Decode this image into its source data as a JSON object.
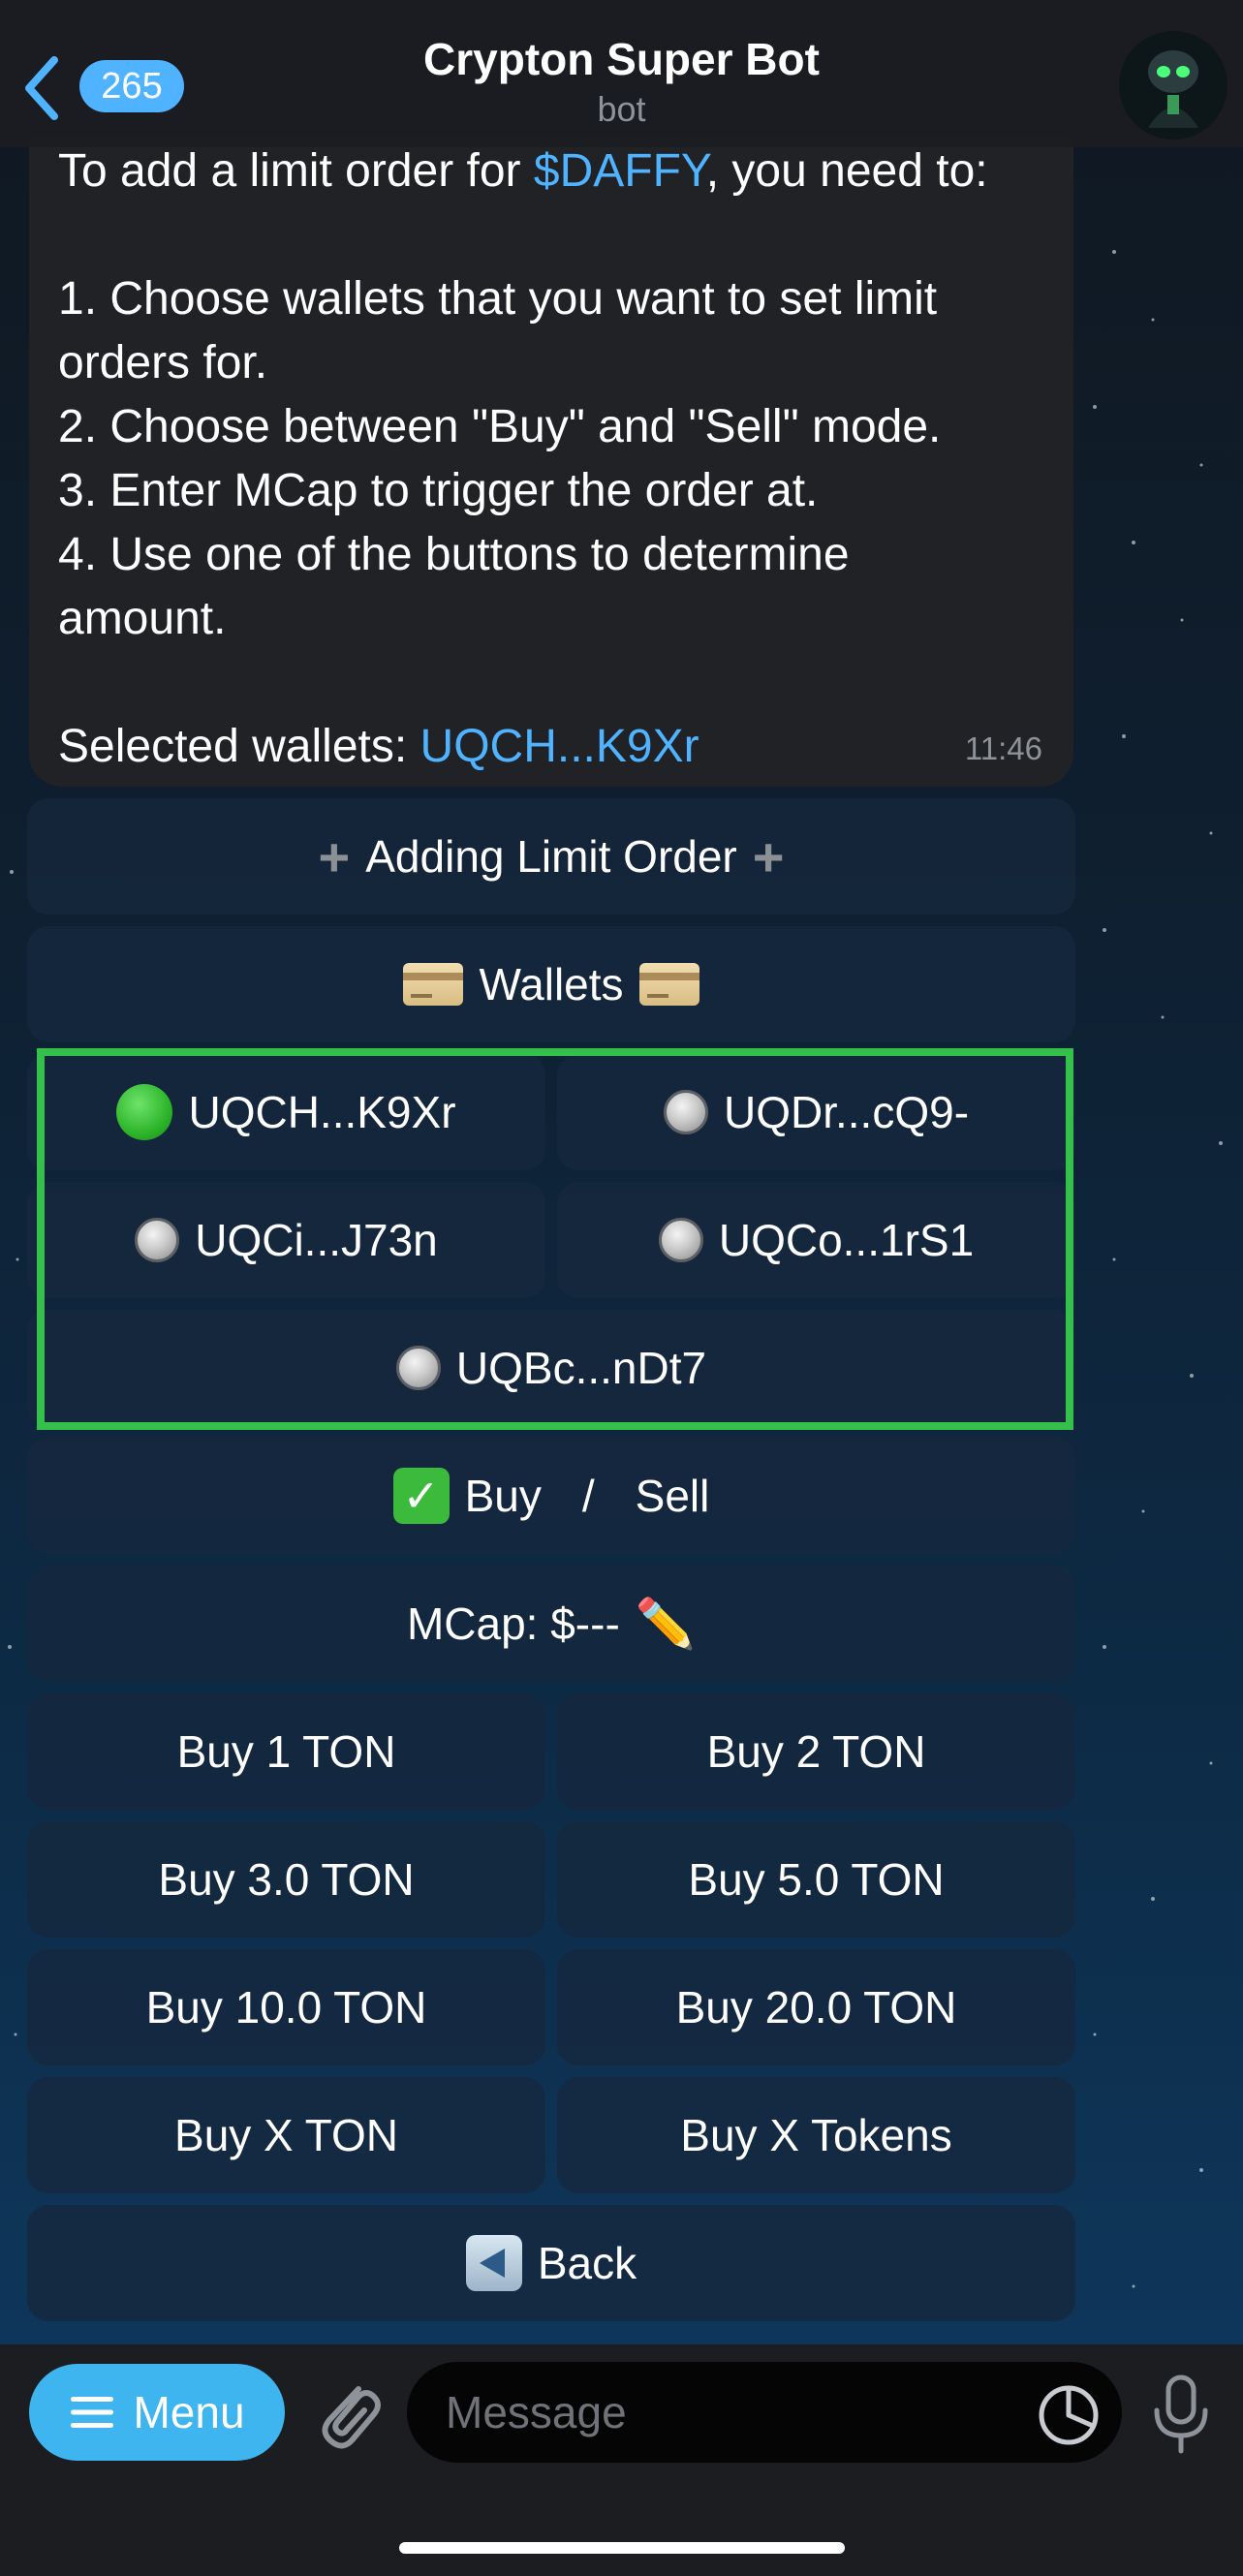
{
  "header": {
    "back_badge": "265",
    "title": "Crypton Super Bot",
    "subtitle": "bot"
  },
  "message": {
    "line1_pre": "To add a limit order for ",
    "line1_link": "$DAFFY",
    "line1_post": ", you need to:",
    "line2": "1. Choose wallets that you want to set limit",
    "line3": "orders for.",
    "line4": "2. Choose between \"Buy\" and \"Sell\" mode.",
    "line5": "3. Enter MCap to trigger the order at.",
    "line6": "4. Use one of the buttons to determine",
    "line7": "amount.",
    "selected_label": "Selected wallets: ",
    "selected_value": "UQCH...K9Xr",
    "time": "11:46"
  },
  "keyboard": {
    "adding": "Adding Limit Order",
    "wallets": "Wallets",
    "wallet_list": [
      {
        "label": "UQCH...K9Xr",
        "selected": true
      },
      {
        "label": "UQDr...cQ9-",
        "selected": false
      },
      {
        "label": "UQCi...J73n",
        "selected": false
      },
      {
        "label": "UQCo...1rS1",
        "selected": false
      },
      {
        "label": "UQBc...nDt7",
        "selected": false
      }
    ],
    "buy": "Buy",
    "slash": "/",
    "sell": "Sell",
    "mcap": "MCap: $---",
    "amounts": [
      "Buy 1 TON",
      "Buy 2 TON",
      "Buy 3.0 TON",
      "Buy 5.0 TON",
      "Buy 10.0 TON",
      "Buy 20.0 TON",
      "Buy X TON",
      "Buy X Tokens"
    ],
    "back": "Back"
  },
  "bottom": {
    "menu": "Menu",
    "message_placeholder": "Message"
  },
  "colors": {
    "accent": "#4fb3ff",
    "highlight": "#34c04a"
  }
}
